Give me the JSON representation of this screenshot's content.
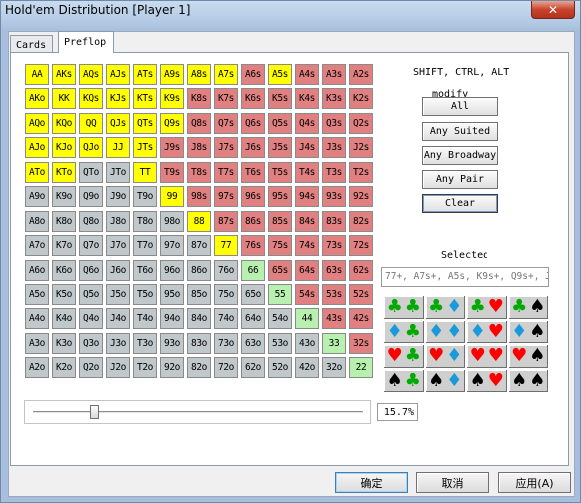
{
  "window": {
    "title": "Hold'em Distribution [Player 1]",
    "close_glyph": "✕"
  },
  "tabs": [
    {
      "label": "Cards",
      "active": false
    },
    {
      "label": "Preflop",
      "active": true
    }
  ],
  "grid": {
    "rows": [
      [
        "AA",
        "AKs",
        "AQs",
        "AJs",
        "ATs",
        "A9s",
        "A8s",
        "A7s",
        "A6s",
        "A5s",
        "A4s",
        "A3s",
        "A2s"
      ],
      [
        "AKo",
        "KK",
        "KQs",
        "KJs",
        "KTs",
        "K9s",
        "K8s",
        "K7s",
        "K6s",
        "K5s",
        "K4s",
        "K3s",
        "K2s"
      ],
      [
        "AQo",
        "KQo",
        "QQ",
        "QJs",
        "QTs",
        "Q9s",
        "Q8s",
        "Q7s",
        "Q6s",
        "Q5s",
        "Q4s",
        "Q3s",
        "Q2s"
      ],
      [
        "AJo",
        "KJo",
        "QJo",
        "JJ",
        "JTs",
        "J9s",
        "J8s",
        "J7s",
        "J6s",
        "J5s",
        "J4s",
        "J3s",
        "J2s"
      ],
      [
        "ATo",
        "KTo",
        "QTo",
        "JTo",
        "TT",
        "T9s",
        "T8s",
        "T7s",
        "T6s",
        "T5s",
        "T4s",
        "T3s",
        "T2s"
      ],
      [
        "A9o",
        "K9o",
        "Q9o",
        "J9o",
        "T9o",
        "99",
        "98s",
        "97s",
        "96s",
        "95s",
        "94s",
        "93s",
        "92s"
      ],
      [
        "A8o",
        "K8o",
        "Q8o",
        "J8o",
        "T8o",
        "98o",
        "88",
        "87s",
        "86s",
        "85s",
        "84s",
        "83s",
        "82s"
      ],
      [
        "A7o",
        "K7o",
        "Q7o",
        "J7o",
        "T7o",
        "97o",
        "87o",
        "77",
        "76s",
        "75s",
        "74s",
        "73s",
        "72s"
      ],
      [
        "A6o",
        "K6o",
        "Q6o",
        "J6o",
        "T6o",
        "96o",
        "86o",
        "76o",
        "66",
        "65s",
        "64s",
        "63s",
        "62s"
      ],
      [
        "A5o",
        "K5o",
        "Q5o",
        "J5o",
        "T5o",
        "95o",
        "85o",
        "75o",
        "65o",
        "55",
        "54s",
        "53s",
        "52s"
      ],
      [
        "A4o",
        "K4o",
        "Q4o",
        "J4o",
        "T4o",
        "94o",
        "84o",
        "74o",
        "64o",
        "54o",
        "44",
        "43s",
        "42s"
      ],
      [
        "A3o",
        "K3o",
        "Q3o",
        "J3o",
        "T3o",
        "93o",
        "83o",
        "73o",
        "63o",
        "53o",
        "43o",
        "33",
        "32s"
      ],
      [
        "A2o",
        "K2o",
        "Q2o",
        "J2o",
        "T2o",
        "92o",
        "82o",
        "72o",
        "62o",
        "52o",
        "42o",
        "32o",
        "22"
      ]
    ],
    "selected": [
      "AA",
      "AKs",
      "AQs",
      "AJs",
      "ATs",
      "A9s",
      "A8s",
      "A7s",
      "A5s",
      "AKo",
      "KK",
      "KQs",
      "KJs",
      "KTs",
      "K9s",
      "AQo",
      "KQo",
      "QQ",
      "QJs",
      "QTs",
      "Q9s",
      "AJo",
      "KJo",
      "QJo",
      "JJ",
      "JTs",
      "ATo",
      "KTo",
      "TT",
      "99",
      "88",
      "77"
    ],
    "colors": {
      "selected": "#ffff00",
      "suited": "#e08080",
      "offsuit": "#c0c8cc",
      "pair": "#b8f0b0"
    }
  },
  "modifiers_label": "SHIFT, CTRL, ALT",
  "modify_label": "modify",
  "buttons": {
    "all": "All",
    "any_suited": "Any Suited",
    "any_broadway": "Any Broadway",
    "any_pair": "Any Pair",
    "clear": "Clear"
  },
  "selected_label": "Selected",
  "range_text": "77+, A7s+, A5s, K9s+, Q9s+, JTs,",
  "suit_matrix": [
    [
      [
        "club",
        "club"
      ],
      [
        "club",
        "diamond"
      ],
      [
        "club",
        "heart"
      ],
      [
        "club",
        "spade"
      ]
    ],
    [
      [
        "diamond",
        "club"
      ],
      [
        "diamond",
        "diamond"
      ],
      [
        "diamond",
        "heart"
      ],
      [
        "diamond",
        "spade"
      ]
    ],
    [
      [
        "heart",
        "club"
      ],
      [
        "heart",
        "diamond"
      ],
      [
        "heart",
        "heart"
      ],
      [
        "heart",
        "spade"
      ]
    ],
    [
      [
        "spade",
        "club"
      ],
      [
        "spade",
        "diamond"
      ],
      [
        "spade",
        "heart"
      ],
      [
        "spade",
        "spade"
      ]
    ]
  ],
  "suit_glyphs": {
    "club": "♣",
    "diamond": "♦",
    "heart": "♥",
    "spade": "♠"
  },
  "suit_colors": {
    "club": "#00aa00",
    "diamond": "#1a9ad8",
    "heart": "#ff0000",
    "spade": "#000000"
  },
  "slider": {
    "value_fraction": 0.157
  },
  "percent_text": "15.7%",
  "dialog_buttons": {
    "ok": "确定",
    "cancel": "取消",
    "apply": "应用(A)"
  }
}
